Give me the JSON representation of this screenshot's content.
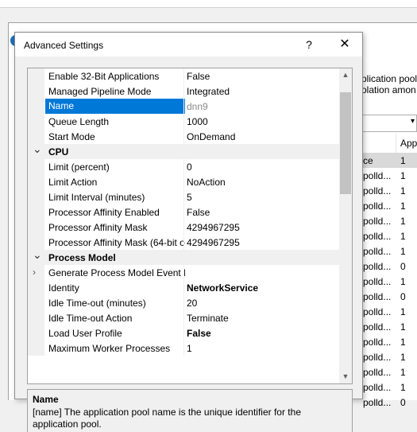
{
  "background": {
    "description_lines": [
      "plication pools",
      "olation amon"
    ],
    "grid_header": "App",
    "rows": [
      {
        "name": "ce",
        "value": "1"
      },
      {
        "name": "polld...",
        "value": "1"
      },
      {
        "name": "polld...",
        "value": "1"
      },
      {
        "name": "polld...",
        "value": "1"
      },
      {
        "name": "polld...",
        "value": "1"
      },
      {
        "name": "polld...",
        "value": "1"
      },
      {
        "name": "polld...",
        "value": "1"
      },
      {
        "name": "polld...",
        "value": "0"
      },
      {
        "name": "polld...",
        "value": "1"
      },
      {
        "name": "polld...",
        "value": "0"
      },
      {
        "name": "polld...",
        "value": "1"
      },
      {
        "name": "polld...",
        "value": "1"
      },
      {
        "name": "polld...",
        "value": "1"
      },
      {
        "name": "polld...",
        "value": "1"
      },
      {
        "name": "polld...",
        "value": "1"
      },
      {
        "name": "polld...",
        "value": "1"
      },
      {
        "name": "polld...",
        "value": "0"
      }
    ]
  },
  "dialog": {
    "title": "Advanced Settings",
    "help_label": "?",
    "close_label": "✕",
    "rows": [
      {
        "name": "Enable 32-Bit Applications",
        "value": "False"
      },
      {
        "name": "Managed Pipeline Mode",
        "value": "Integrated"
      },
      {
        "name": "Name",
        "value": "dnn9",
        "selected": true,
        "grey": true
      },
      {
        "name": "Queue Length",
        "value": "1000"
      },
      {
        "name": "Start Mode",
        "value": "OnDemand"
      },
      {
        "name": "CPU",
        "value": "",
        "category": true,
        "expander": "v"
      },
      {
        "name": "Limit (percent)",
        "value": "0"
      },
      {
        "name": "Limit Action",
        "value": "NoAction"
      },
      {
        "name": "Limit Interval (minutes)",
        "value": "5"
      },
      {
        "name": "Processor Affinity Enabled",
        "value": "False"
      },
      {
        "name": "Processor Affinity Mask",
        "value": "4294967295"
      },
      {
        "name": "Processor Affinity Mask (64-bit o",
        "value": "4294967295"
      },
      {
        "name": "Process Model",
        "value": "",
        "category": true,
        "expander": "v"
      },
      {
        "name": "Generate Process Model Event L",
        "value": "",
        "expander": ">"
      },
      {
        "name": "Identity",
        "value": "NetworkService",
        "bold": true
      },
      {
        "name": "Idle Time-out (minutes)",
        "value": "20"
      },
      {
        "name": "Idle Time-out Action",
        "value": "Terminate"
      },
      {
        "name": "Load User Profile",
        "value": "False",
        "bold": true
      },
      {
        "name": "Maximum Worker Processes",
        "value": "1"
      }
    ],
    "description": {
      "title": "Name",
      "text": "[name] The application pool name is the unique identifier for the application pool."
    }
  }
}
